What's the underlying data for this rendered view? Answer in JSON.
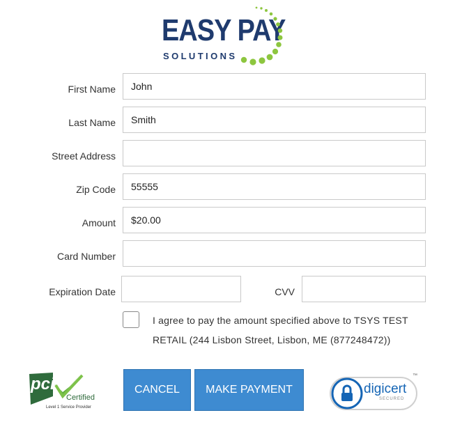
{
  "logo": {
    "main": "EASY PAY",
    "sub": "SOLUTIONS"
  },
  "form": {
    "first_name": {
      "label": "First Name",
      "value": "John"
    },
    "last_name": {
      "label": "Last Name",
      "value": "Smith"
    },
    "street_address": {
      "label": "Street Address",
      "value": ""
    },
    "zip_code": {
      "label": "Zip Code",
      "value": "55555"
    },
    "amount": {
      "label": "Amount",
      "value": "$20.00"
    },
    "card_number": {
      "label": "Card Number",
      "value": ""
    },
    "expiration_date": {
      "label": "Expiration Date",
      "value": ""
    },
    "cvv": {
      "label": "CVV",
      "value": ""
    },
    "agree_text": "I agree to pay the amount specified above to TSYS TEST RETAIL (244 Lisbon Street, Lisbon, ME (877248472))",
    "agree_checked": false
  },
  "buttons": {
    "cancel": "CANCEL",
    "make_payment": "MAKE PAYMENT"
  },
  "badges": {
    "pci": {
      "logo": "pci",
      "certified": "Certified",
      "caption": "Level 1 Service Provider"
    },
    "digicert": {
      "brand": "digicert",
      "tm": "™",
      "secured": "SECURED"
    }
  },
  "colors": {
    "brand_navy": "#1f3b6e",
    "brand_green": "#8dc63f",
    "button_blue": "#3e8bd1"
  }
}
